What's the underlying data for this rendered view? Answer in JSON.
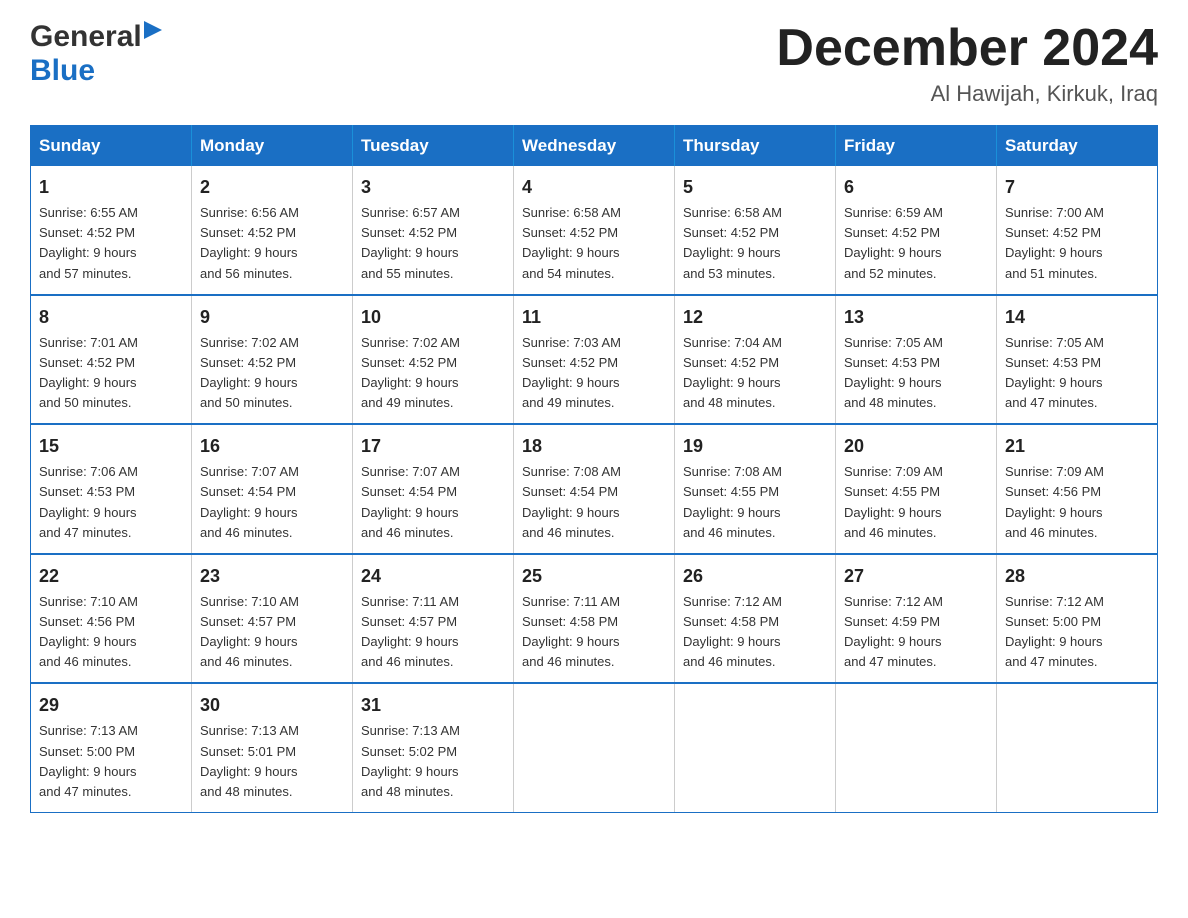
{
  "header": {
    "logo_general": "General",
    "logo_blue": "Blue",
    "month_title": "December 2024",
    "subtitle": "Al Hawijah, Kirkuk, Iraq"
  },
  "days_of_week": [
    "Sunday",
    "Monday",
    "Tuesday",
    "Wednesday",
    "Thursday",
    "Friday",
    "Saturday"
  ],
  "weeks": [
    [
      {
        "day": "1",
        "sunrise": "6:55 AM",
        "sunset": "4:52 PM",
        "daylight": "9 hours and 57 minutes."
      },
      {
        "day": "2",
        "sunrise": "6:56 AM",
        "sunset": "4:52 PM",
        "daylight": "9 hours and 56 minutes."
      },
      {
        "day": "3",
        "sunrise": "6:57 AM",
        "sunset": "4:52 PM",
        "daylight": "9 hours and 55 minutes."
      },
      {
        "day": "4",
        "sunrise": "6:58 AM",
        "sunset": "4:52 PM",
        "daylight": "9 hours and 54 minutes."
      },
      {
        "day": "5",
        "sunrise": "6:58 AM",
        "sunset": "4:52 PM",
        "daylight": "9 hours and 53 minutes."
      },
      {
        "day": "6",
        "sunrise": "6:59 AM",
        "sunset": "4:52 PM",
        "daylight": "9 hours and 52 minutes."
      },
      {
        "day": "7",
        "sunrise": "7:00 AM",
        "sunset": "4:52 PM",
        "daylight": "9 hours and 51 minutes."
      }
    ],
    [
      {
        "day": "8",
        "sunrise": "7:01 AM",
        "sunset": "4:52 PM",
        "daylight": "9 hours and 50 minutes."
      },
      {
        "day": "9",
        "sunrise": "7:02 AM",
        "sunset": "4:52 PM",
        "daylight": "9 hours and 50 minutes."
      },
      {
        "day": "10",
        "sunrise": "7:02 AM",
        "sunset": "4:52 PM",
        "daylight": "9 hours and 49 minutes."
      },
      {
        "day": "11",
        "sunrise": "7:03 AM",
        "sunset": "4:52 PM",
        "daylight": "9 hours and 49 minutes."
      },
      {
        "day": "12",
        "sunrise": "7:04 AM",
        "sunset": "4:52 PM",
        "daylight": "9 hours and 48 minutes."
      },
      {
        "day": "13",
        "sunrise": "7:05 AM",
        "sunset": "4:53 PM",
        "daylight": "9 hours and 48 minutes."
      },
      {
        "day": "14",
        "sunrise": "7:05 AM",
        "sunset": "4:53 PM",
        "daylight": "9 hours and 47 minutes."
      }
    ],
    [
      {
        "day": "15",
        "sunrise": "7:06 AM",
        "sunset": "4:53 PM",
        "daylight": "9 hours and 47 minutes."
      },
      {
        "day": "16",
        "sunrise": "7:07 AM",
        "sunset": "4:54 PM",
        "daylight": "9 hours and 46 minutes."
      },
      {
        "day": "17",
        "sunrise": "7:07 AM",
        "sunset": "4:54 PM",
        "daylight": "9 hours and 46 minutes."
      },
      {
        "day": "18",
        "sunrise": "7:08 AM",
        "sunset": "4:54 PM",
        "daylight": "9 hours and 46 minutes."
      },
      {
        "day": "19",
        "sunrise": "7:08 AM",
        "sunset": "4:55 PM",
        "daylight": "9 hours and 46 minutes."
      },
      {
        "day": "20",
        "sunrise": "7:09 AM",
        "sunset": "4:55 PM",
        "daylight": "9 hours and 46 minutes."
      },
      {
        "day": "21",
        "sunrise": "7:09 AM",
        "sunset": "4:56 PM",
        "daylight": "9 hours and 46 minutes."
      }
    ],
    [
      {
        "day": "22",
        "sunrise": "7:10 AM",
        "sunset": "4:56 PM",
        "daylight": "9 hours and 46 minutes."
      },
      {
        "day": "23",
        "sunrise": "7:10 AM",
        "sunset": "4:57 PM",
        "daylight": "9 hours and 46 minutes."
      },
      {
        "day": "24",
        "sunrise": "7:11 AM",
        "sunset": "4:57 PM",
        "daylight": "9 hours and 46 minutes."
      },
      {
        "day": "25",
        "sunrise": "7:11 AM",
        "sunset": "4:58 PM",
        "daylight": "9 hours and 46 minutes."
      },
      {
        "day": "26",
        "sunrise": "7:12 AM",
        "sunset": "4:58 PM",
        "daylight": "9 hours and 46 minutes."
      },
      {
        "day": "27",
        "sunrise": "7:12 AM",
        "sunset": "4:59 PM",
        "daylight": "9 hours and 47 minutes."
      },
      {
        "day": "28",
        "sunrise": "7:12 AM",
        "sunset": "5:00 PM",
        "daylight": "9 hours and 47 minutes."
      }
    ],
    [
      {
        "day": "29",
        "sunrise": "7:13 AM",
        "sunset": "5:00 PM",
        "daylight": "9 hours and 47 minutes."
      },
      {
        "day": "30",
        "sunrise": "7:13 AM",
        "sunset": "5:01 PM",
        "daylight": "9 hours and 48 minutes."
      },
      {
        "day": "31",
        "sunrise": "7:13 AM",
        "sunset": "5:02 PM",
        "daylight": "9 hours and 48 minutes."
      },
      null,
      null,
      null,
      null
    ]
  ],
  "labels": {
    "sunrise": "Sunrise:",
    "sunset": "Sunset:",
    "daylight": "Daylight:"
  }
}
